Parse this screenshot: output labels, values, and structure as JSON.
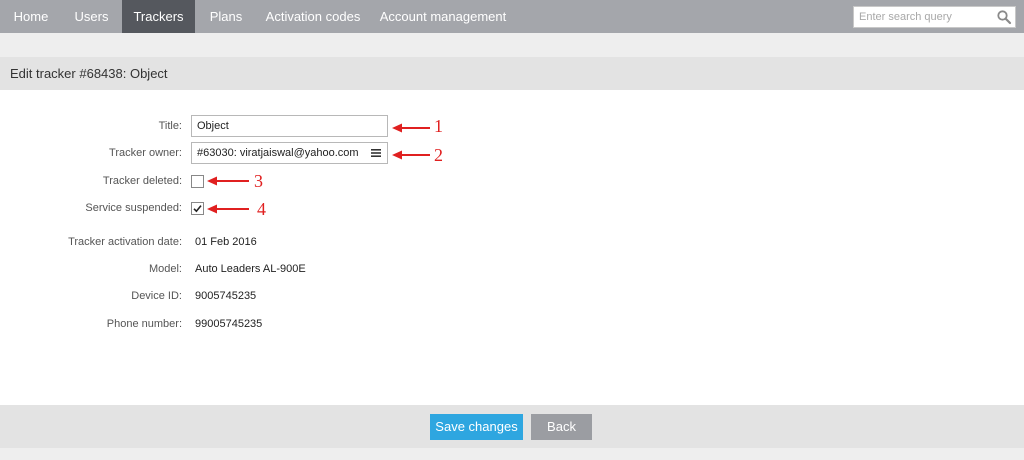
{
  "nav": {
    "items": [
      {
        "label": "Home"
      },
      {
        "label": "Users"
      },
      {
        "label": "Trackers",
        "active": true
      },
      {
        "label": "Plans"
      },
      {
        "label": "Activation codes"
      },
      {
        "label": "Account management"
      }
    ],
    "search_placeholder": "Enter search query",
    "search_icon": "magnifier-icon"
  },
  "page": {
    "title": "Edit tracker #68438: Object"
  },
  "form": {
    "title_label": "Title:",
    "title_value": "Object",
    "owner_label": "Tracker owner:",
    "owner_value": "#63030: viratjaiswal@yahoo.com",
    "owner_icon": "list-icon",
    "deleted_label": "Tracker deleted:",
    "deleted_checked": false,
    "suspended_label": "Service suspended:",
    "suspended_checked": true,
    "activation_label": "Tracker activation date:",
    "activation_value": "01 Feb 2016",
    "model_label": "Model:",
    "model_value": "Auto Leaders AL-900E",
    "device_label": "Device ID:",
    "device_value": "9005745235",
    "phone_label": "Phone number:",
    "phone_value": "99005745235"
  },
  "annotations": [
    "1",
    "2",
    "3",
    "4"
  ],
  "colors": {
    "navbar": "#a4a6ab",
    "nav_active": "#55585e",
    "save_button": "#2ea6e0",
    "back_button": "#9b9da2",
    "annotation": "#e02020"
  },
  "footer": {
    "save_label": "Save changes",
    "back_label": "Back"
  }
}
